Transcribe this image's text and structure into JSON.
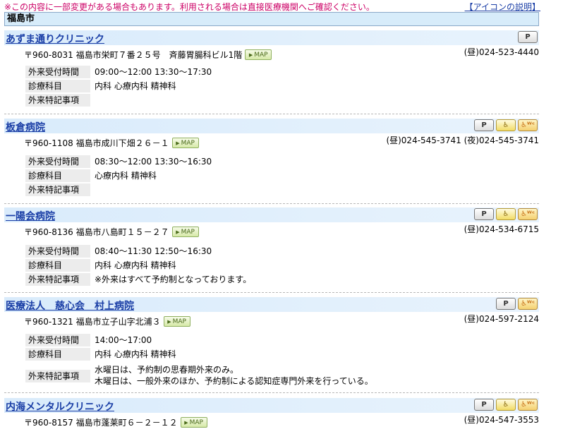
{
  "notice": "※この内容に一部変更がある場合もあります。利用される場合は直接医療機関へご確認ください。",
  "icon_link": "【アイコンの説明】",
  "city": "福島市",
  "labels": {
    "hours": "外来受付時間",
    "departments": "診療科目",
    "notes": "外来特記事項",
    "map": "MAP",
    "parking": "P"
  },
  "entries": [
    {
      "name": "あずま通りクリニック",
      "badges": [
        "parking"
      ],
      "address": "〒960-8031 福島市栄町７番２５号　斉藤胃腸科ビル1階",
      "tel": "(昼)024-523-4440",
      "hours": "09:00〜12:00 13:30〜17:30",
      "departments": "内科 心療内科 精神科",
      "notes": ""
    },
    {
      "name": "板倉病院",
      "badges": [
        "parking",
        "accessible",
        "accessible-wc"
      ],
      "address": "〒960-1108 福島市成川下畑２６－１",
      "tel": "(昼)024-545-3741 (夜)024-545-3741",
      "hours": "08:30〜12:00 13:30〜16:30",
      "departments": "心療内科 精神科",
      "notes": ""
    },
    {
      "name": "一陽会病院",
      "badges": [
        "parking",
        "accessible",
        "accessible-wc"
      ],
      "address": "〒960-8136 福島市八島町１５－２７",
      "tel": "(昼)024-534-6715",
      "hours": "08:40〜11:30 12:50〜16:30",
      "departments": "内科 心療内科 精神科",
      "notes": "※外来はすべて予約制となっております。"
    },
    {
      "name": "医療法人　慈心会　村上病院",
      "badges": [
        "parking",
        "accessible-wc"
      ],
      "address": "〒960-1321 福島市立子山字北浦３",
      "tel": "(昼)024-597-2124",
      "hours": "14:00〜17:00",
      "departments": "内科 心療内科 精神科",
      "notes_line1": "水曜日は、予約制の思春期外来のみ。",
      "notes_line2": "木曜日は、一般外来のほか、予約制による認知症専門外来を行っている。"
    },
    {
      "name": "内海メンタルクリニック",
      "badges": [
        "parking",
        "accessible",
        "accessible-wc"
      ],
      "address": "〒960-8157 福島市蓬莱町６－２－１２",
      "tel": "(昼)024-547-3553"
    }
  ]
}
